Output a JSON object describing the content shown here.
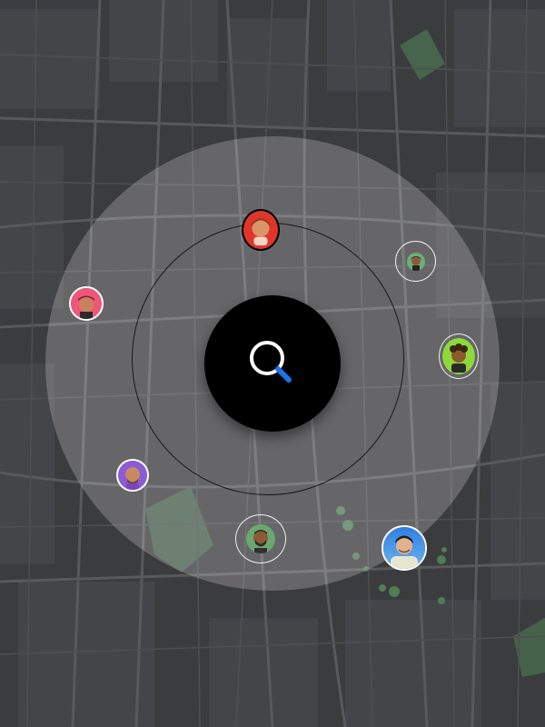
{
  "screen": {
    "name": "nearby-people-radar"
  },
  "search": {
    "icon": "search-icon",
    "accent": "#1a73e8"
  },
  "colors": {
    "map_background": "#3d3e40",
    "map_roads": "#57595c",
    "park": "#4a6b4f"
  },
  "people": [
    {
      "id": "avatar-red-beanie-girl",
      "bg": "#e2352a",
      "skin": "#d9946a",
      "hair": "#a63a22"
    },
    {
      "id": "avatar-tiny-dark-hair",
      "bg": "#6fae78",
      "skin": "#8a5a3a",
      "hair": "#1a1a1a"
    },
    {
      "id": "avatar-pink-cap",
      "bg": "#f0567a",
      "skin": "#c8835e",
      "hair": "#7a1f2d"
    },
    {
      "id": "avatar-green-curly",
      "bg": "#8ed83a",
      "skin": "#8b5a2e",
      "hair": "#3a2612"
    },
    {
      "id": "avatar-purple-bald",
      "bg": "#8b5cd6",
      "skin": "#c88a60",
      "hair": "#6b4a2c"
    },
    {
      "id": "avatar-green-beard",
      "bg": "#6aa86f",
      "skin": "#8a5a37",
      "hair": "#2c2c2c"
    },
    {
      "id": "avatar-photo-man",
      "bg": "#3e8ce0",
      "skin": "#e0b38c",
      "hair": "#1c1c1c"
    }
  ]
}
